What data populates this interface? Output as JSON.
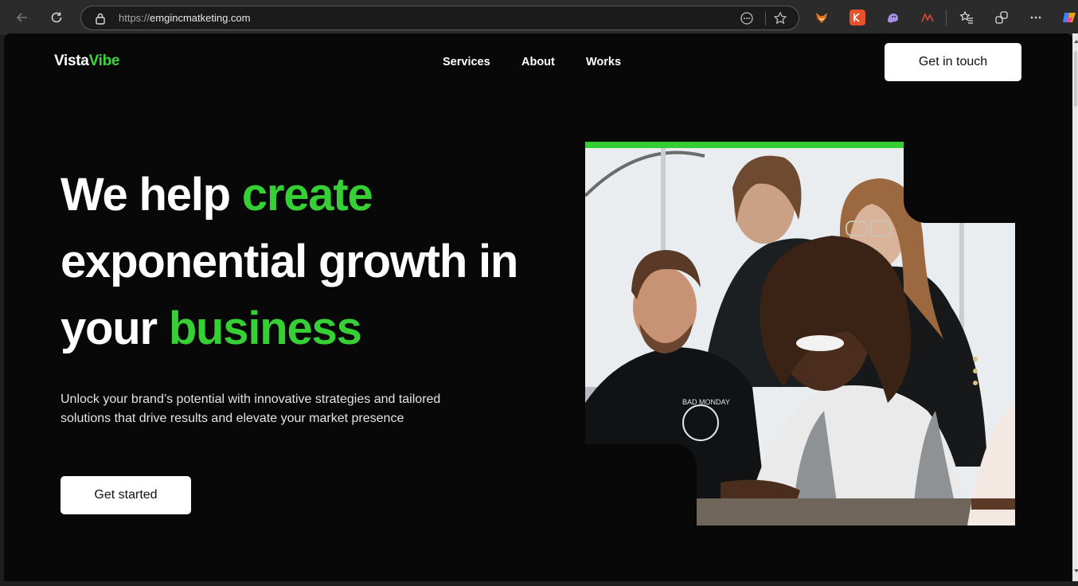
{
  "browser": {
    "url_protocol": "https://",
    "url_host": "emgincmatketing.com"
  },
  "site": {
    "logo_main": "Vista",
    "logo_accent": "Vibe",
    "nav": [
      "Services",
      "About",
      "Works"
    ],
    "cta_top": "Get in touch"
  },
  "hero": {
    "line1_white": "We help ",
    "line1_green": "create",
    "line2_white": "exponential growth in",
    "line3_white": "your ",
    "line3_green": "business",
    "subtitle": "Unlock your brand’s potential with innovative strategies and tailored solutions that drive results and elevate your market presence",
    "cta": "Get started"
  },
  "colors": {
    "accent": "#36cf36",
    "background": "#080808",
    "button_bg": "#ffffff"
  }
}
